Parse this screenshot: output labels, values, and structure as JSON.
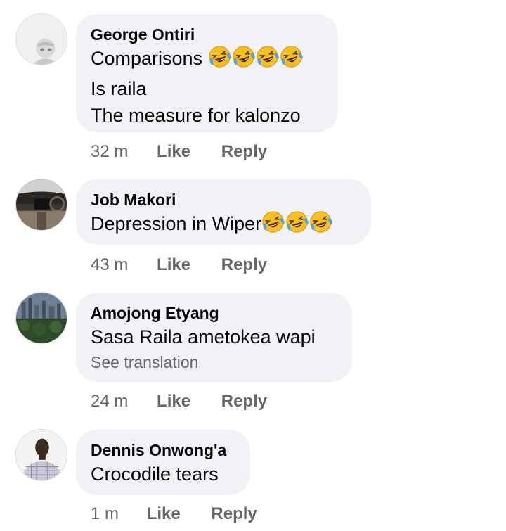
{
  "comments": [
    {
      "author": "George Ontiri",
      "lines": [
        "Comparisons",
        "Is raila",
        "The measure for kalonzo"
      ],
      "emoji_count_line0": 4,
      "emoji": "face-with-tears-of-joy",
      "time": "32 m",
      "like": "Like",
      "reply": "Reply"
    },
    {
      "author": "Job Makori",
      "lines": [
        "Depression in Wiper"
      ],
      "emoji_count_line0": 3,
      "emoji": "face-with-tears-of-joy",
      "time": "43 m",
      "like": "Like",
      "reply": "Reply"
    },
    {
      "author": "Amojong Etyang",
      "lines": [
        "Sasa Raila ametokea wapi"
      ],
      "translation": "See translation",
      "time": "24 m",
      "like": "Like",
      "reply": "Reply"
    },
    {
      "author": "Dennis Onwong'a",
      "lines": [
        "Crocodile tears"
      ],
      "time": "1 m",
      "like": "Like",
      "reply": "Reply"
    }
  ]
}
